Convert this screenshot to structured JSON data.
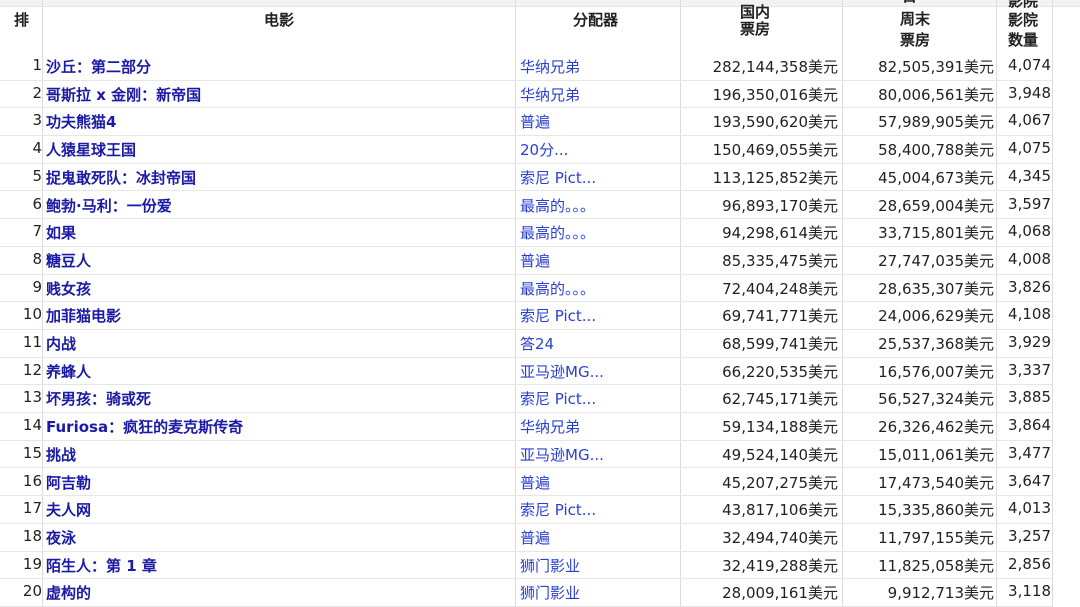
{
  "header": {
    "rank": "排",
    "movie": "电影",
    "distributor": "分配器",
    "gross_line1": "国内",
    "gross_line2": "票房",
    "weekend_line0": "首",
    "weekend_line1": "周末",
    "weekend_line2": "票房",
    "theaters_line0": "影院",
    "theaters_line1": "影院",
    "theaters_line2": "数量"
  },
  "rows": [
    {
      "rank": "1",
      "title": "沙丘：第二部分",
      "distributor": "华纳兄弟",
      "gross": "282,144,358美元",
      "weekend": "82,505,391美元",
      "theaters": "4,074"
    },
    {
      "rank": "2",
      "title": "哥斯拉 x 金刚：新帝国",
      "distributor": "华纳兄弟",
      "gross": "196,350,016美元",
      "weekend": "80,006,561美元",
      "theaters": "3,948"
    },
    {
      "rank": "3",
      "title": "功夫熊猫4",
      "distributor": "普遍",
      "gross": "193,590,620美元",
      "weekend": "57,989,905美元",
      "theaters": "4,067"
    },
    {
      "rank": "4",
      "title": "人猿星球王国",
      "distributor": "20分...",
      "gross": "150,469,055美元",
      "weekend": "58,400,788美元",
      "theaters": "4,075"
    },
    {
      "rank": "5",
      "title": "捉鬼敢死队：冰封帝国",
      "distributor": "索尼 Pict...",
      "gross": "113,125,852美元",
      "weekend": "45,004,673美元",
      "theaters": "4,345"
    },
    {
      "rank": "6",
      "title": "鲍勃·马利：一份爱",
      "distributor": "最高的。。。",
      "gross": "96,893,170美元",
      "weekend": "28,659,004美元",
      "theaters": "3,597"
    },
    {
      "rank": "7",
      "title": "如果",
      "distributor": "最高的。。。",
      "gross": "94,298,614美元",
      "weekend": "33,715,801美元",
      "theaters": "4,068"
    },
    {
      "rank": "8",
      "title": "糖豆人",
      "distributor": "普遍",
      "gross": "85,335,475美元",
      "weekend": "27,747,035美元",
      "theaters": "4,008"
    },
    {
      "rank": "9",
      "title": "贱女孩",
      "distributor": "最高的。。。",
      "gross": "72,404,248美元",
      "weekend": "28,635,307美元",
      "theaters": "3,826"
    },
    {
      "rank": "10",
      "title": "加菲猫电影",
      "distributor": "索尼 Pict...",
      "gross": "69,741,771美元",
      "weekend": "24,006,629美元",
      "theaters": "4,108"
    },
    {
      "rank": "11",
      "title": "内战",
      "distributor": "答24",
      "gross": "68,599,741美元",
      "weekend": "25,537,368美元",
      "theaters": "3,929"
    },
    {
      "rank": "12",
      "title": "养蜂人",
      "distributor": "亚马逊MG...",
      "gross": "66,220,535美元",
      "weekend": "16,576,007美元",
      "theaters": "3,337"
    },
    {
      "rank": "13",
      "title": "坏男孩：骑或死",
      "distributor": "索尼 Pict...",
      "gross": "62,745,171美元",
      "weekend": "56,527,324美元",
      "theaters": "3,885"
    },
    {
      "rank": "14",
      "title": "Furiosa：疯狂的麦克斯传奇",
      "distributor": "华纳兄弟",
      "gross": "59,134,188美元",
      "weekend": "26,326,462美元",
      "theaters": "3,864"
    },
    {
      "rank": "15",
      "title": "挑战",
      "distributor": "亚马逊MG...",
      "gross": "49,524,140美元",
      "weekend": "15,011,061美元",
      "theaters": "3,477"
    },
    {
      "rank": "16",
      "title": "阿吉勒",
      "distributor": "普遍",
      "gross": "45,207,275美元",
      "weekend": "17,473,540美元",
      "theaters": "3,647"
    },
    {
      "rank": "17",
      "title": "夫人网",
      "distributor": "索尼 Pict...",
      "gross": "43,817,106美元",
      "weekend": "15,335,860美元",
      "theaters": "4,013"
    },
    {
      "rank": "18",
      "title": "夜泳",
      "distributor": "普遍",
      "gross": "32,494,740美元",
      "weekend": "11,797,155美元",
      "theaters": "3,257"
    },
    {
      "rank": "19",
      "title": "陌生人：第 1 章",
      "distributor": "狮门影业",
      "gross": "32,419,288美元",
      "weekend": "11,825,058美元",
      "theaters": "2,856"
    },
    {
      "rank": "20",
      "title": "虚构的",
      "distributor": "狮门影业",
      "gross": "28,009,161美元",
      "weekend": "9,912,713美元",
      "theaters": "3,118"
    }
  ]
}
